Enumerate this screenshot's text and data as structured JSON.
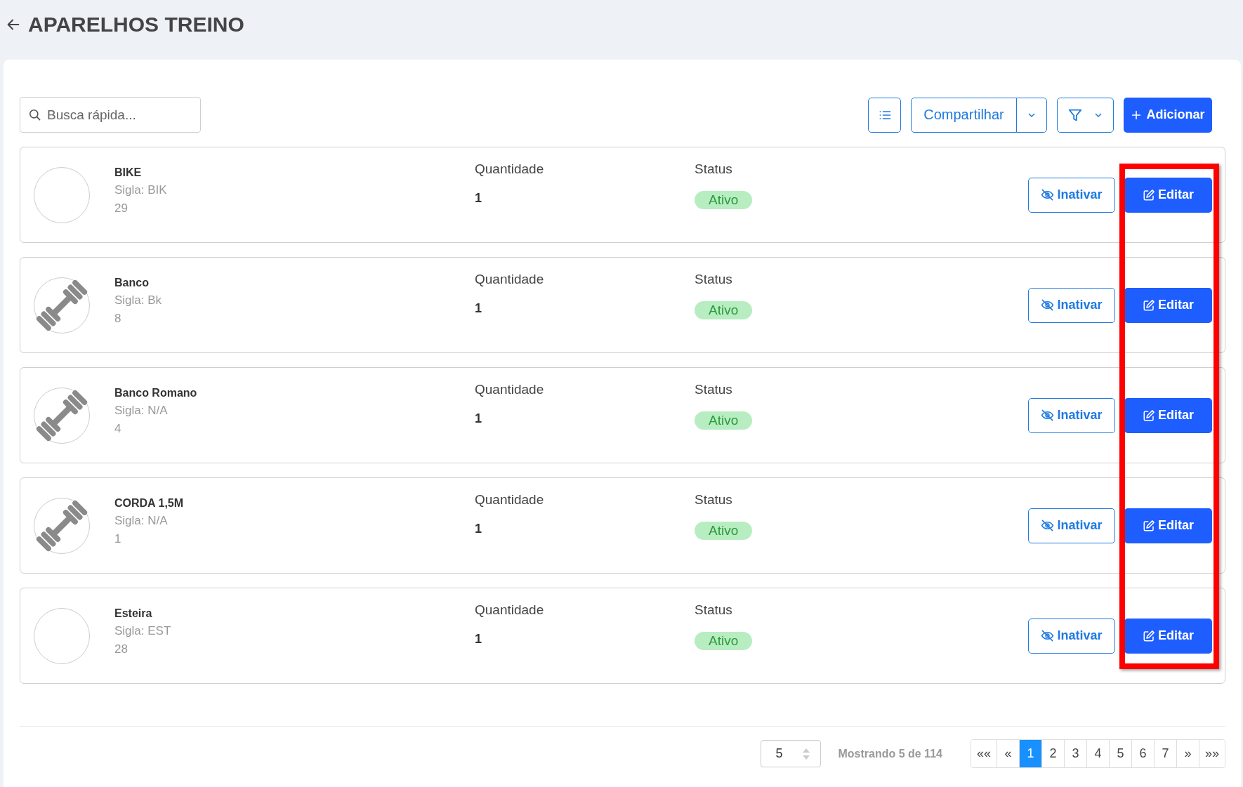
{
  "header": {
    "title": "APARELHOS TREINO"
  },
  "search": {
    "placeholder": "Busca rápida..."
  },
  "toolbar": {
    "share_label": "Compartilhar",
    "add_label": "Adicionar"
  },
  "items": [
    {
      "name": "BIKE",
      "sigla": "Sigla: BIK",
      "code": "29",
      "kind": "blank",
      "quantity_label": "Quantidade",
      "quantity": "1",
      "status_label": "Status",
      "status": "Ativo",
      "deactivate_label": "Inativar",
      "edit_label": "Editar"
    },
    {
      "name": "Banco",
      "sigla": "Sigla: Bk",
      "code": "8",
      "kind": "dumbbell",
      "quantity_label": "Quantidade",
      "quantity": "1",
      "status_label": "Status",
      "status": "Ativo",
      "deactivate_label": "Inativar",
      "edit_label": "Editar"
    },
    {
      "name": "Banco Romano",
      "sigla": "Sigla: N/A",
      "code": "4",
      "kind": "dumbbell",
      "quantity_label": "Quantidade",
      "quantity": "1",
      "status_label": "Status",
      "status": "Ativo",
      "deactivate_label": "Inativar",
      "edit_label": "Editar"
    },
    {
      "name": "CORDA 1,5M",
      "sigla": "Sigla: N/A",
      "code": "1",
      "kind": "dumbbell",
      "quantity_label": "Quantidade",
      "quantity": "1",
      "status_label": "Status",
      "status": "Ativo",
      "deactivate_label": "Inativar",
      "edit_label": "Editar"
    },
    {
      "name": "Esteira",
      "sigla": "Sigla: EST",
      "code": "28",
      "kind": "blank",
      "quantity_label": "Quantidade",
      "quantity": "1",
      "status_label": "Status",
      "status": "Ativo",
      "deactivate_label": "Inativar",
      "edit_label": "Editar"
    }
  ],
  "highlight_edit_column": true,
  "footer": {
    "page_size": "5",
    "summary": "Mostrando 5 de 114",
    "pages": [
      {
        "label": "««",
        "selected": false
      },
      {
        "label": "«",
        "selected": false
      },
      {
        "label": "1",
        "selected": true
      },
      {
        "label": "2",
        "selected": false
      },
      {
        "label": "3",
        "selected": false
      },
      {
        "label": "4",
        "selected": false
      },
      {
        "label": "5",
        "selected": false
      },
      {
        "label": "6",
        "selected": false
      },
      {
        "label": "7",
        "selected": false
      },
      {
        "label": "»",
        "selected": false
      },
      {
        "label": "»»",
        "selected": false
      }
    ]
  }
}
